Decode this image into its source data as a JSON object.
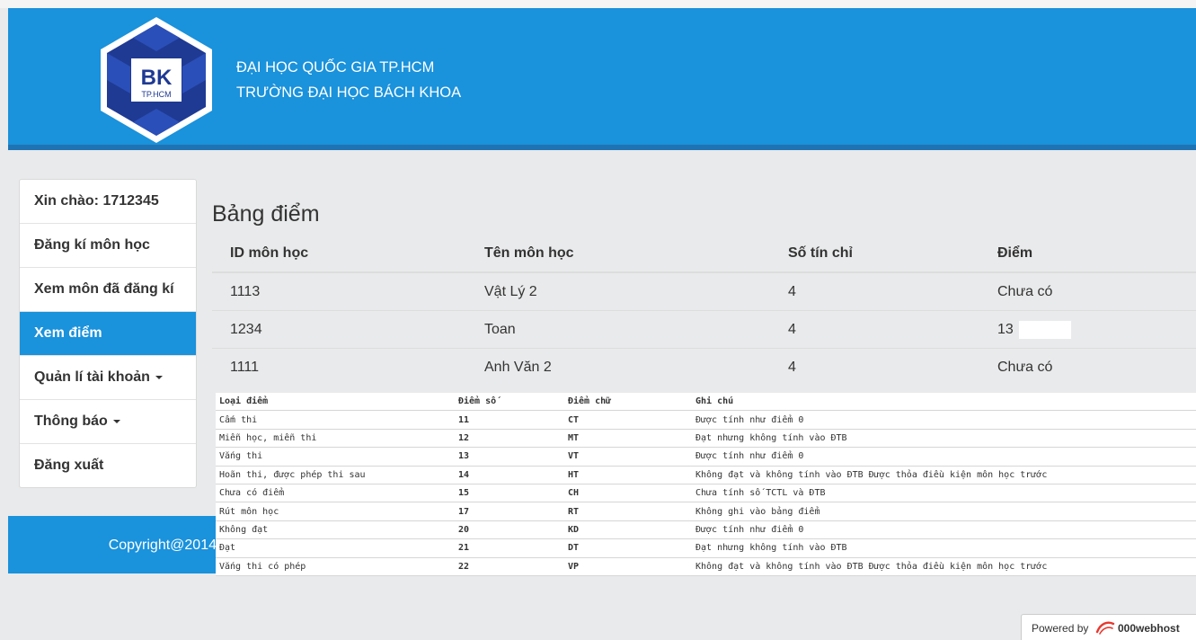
{
  "header": {
    "logo_text": "BK",
    "logo_subtext": "TP.HCM",
    "line1": "ĐẠI HỌC QUỐC GIA TP.HCM",
    "line2": "TRƯỜNG ĐẠI HỌC BÁCH KHOA",
    "bg_color": "#1a92dc"
  },
  "sidebar": {
    "items": [
      {
        "label": "Xin chào: 1712345"
      },
      {
        "label": "Đăng kí môn học"
      },
      {
        "label": "Xem môn đã đăng kí"
      },
      {
        "label": "Xem điểm",
        "active": true
      },
      {
        "label": "Quản lí tài khoản",
        "dropdown": true
      },
      {
        "label": "Thông báo",
        "dropdown": true
      },
      {
        "label": "Đăng xuất"
      }
    ]
  },
  "footer": {
    "copyright": "Copyright@2014"
  },
  "main": {
    "title": "Bảng điểm",
    "columns": [
      "ID môn học",
      "Tên môn học",
      "Số tín chỉ",
      "Điểm"
    ],
    "rows": [
      [
        "1113",
        "Vật Lý 2",
        "4",
        "Chưa có"
      ],
      [
        "1234",
        "Toan",
        "4",
        "13"
      ],
      [
        "1111",
        "Anh Văn 2",
        "4",
        "Chưa có"
      ]
    ]
  },
  "legend": {
    "columns": [
      "Loại điểm",
      "Điểm số",
      "Điểm chữ",
      "Ghi chú"
    ],
    "rows": [
      [
        "Cấm thi",
        "11",
        "CT",
        "Được tính như điểm 0"
      ],
      [
        "Miễn học, miễn thi",
        "12",
        "MT",
        "Đạt nhưng không tính vào ĐTB"
      ],
      [
        "Vắng thi",
        "13",
        "VT",
        "Được tính như điểm 0"
      ],
      [
        "Hoãn thi, được phép thi sau",
        "14",
        "HT",
        "Không đạt và không tính vào ĐTB Được thỏa điều kiện môn học trước"
      ],
      [
        "Chưa có điểm",
        "15",
        "CH",
        "Chưa tính số TCTL và ĐTB"
      ],
      [
        "Rút môn học",
        "17",
        "RT",
        "Không ghi vào bảng điểm"
      ],
      [
        "Không đạt",
        "20",
        "KD",
        "Được tính như điểm 0"
      ],
      [
        "Đạt",
        "21",
        "DT",
        "Đạt nhưng không tính vào ĐTB"
      ],
      [
        "Vắng thi có phép",
        "22",
        "VP",
        "Không đạt và không tính vào ĐTB Được thỏa điều kiện môn học trước"
      ]
    ]
  },
  "powered": {
    "prefix": "Powered by",
    "brand": "000webhost"
  }
}
